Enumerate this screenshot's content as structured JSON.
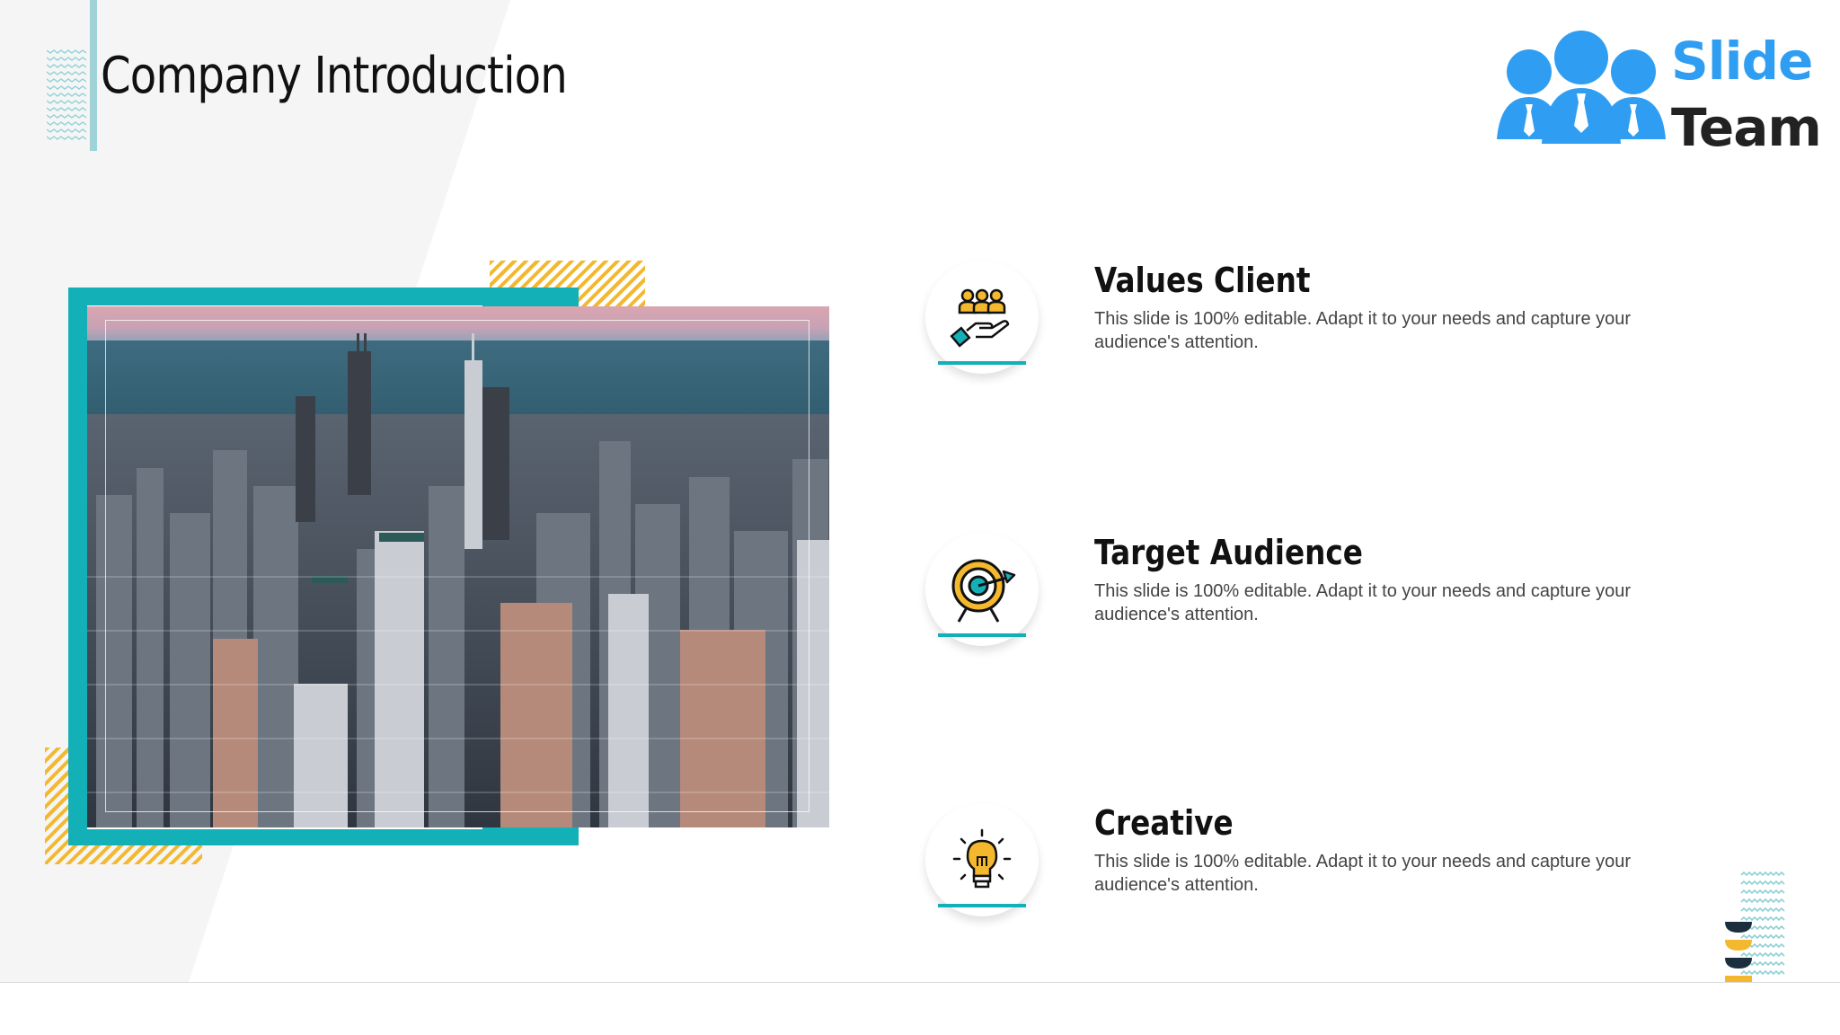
{
  "header": {
    "title": "Company Introduction"
  },
  "logo": {
    "word1": "Slide",
    "word2": "Team",
    "brand_color": "#2f9ef2"
  },
  "photo": {
    "subject": "aerial view of city skyline beside a lake at dusk"
  },
  "items": [
    {
      "heading": "Values Client",
      "text": "This slide is 100% editable. Adapt it to your needs and capture your audience's attention.",
      "icon": "hand-holding-people-icon"
    },
    {
      "heading": "Target Audience",
      "text": "This slide is 100% editable. Adapt it to your needs and capture your audience's attention.",
      "icon": "target-arrow-icon"
    },
    {
      "heading": "Creative",
      "text": "This slide is 100% editable. Adapt it to your needs and capture your audience's attention.",
      "icon": "lightbulb-icon"
    }
  ],
  "colors": {
    "accent": "#14b0b8",
    "hatch": "#f3b82e",
    "navy": "#1c2f3e"
  }
}
